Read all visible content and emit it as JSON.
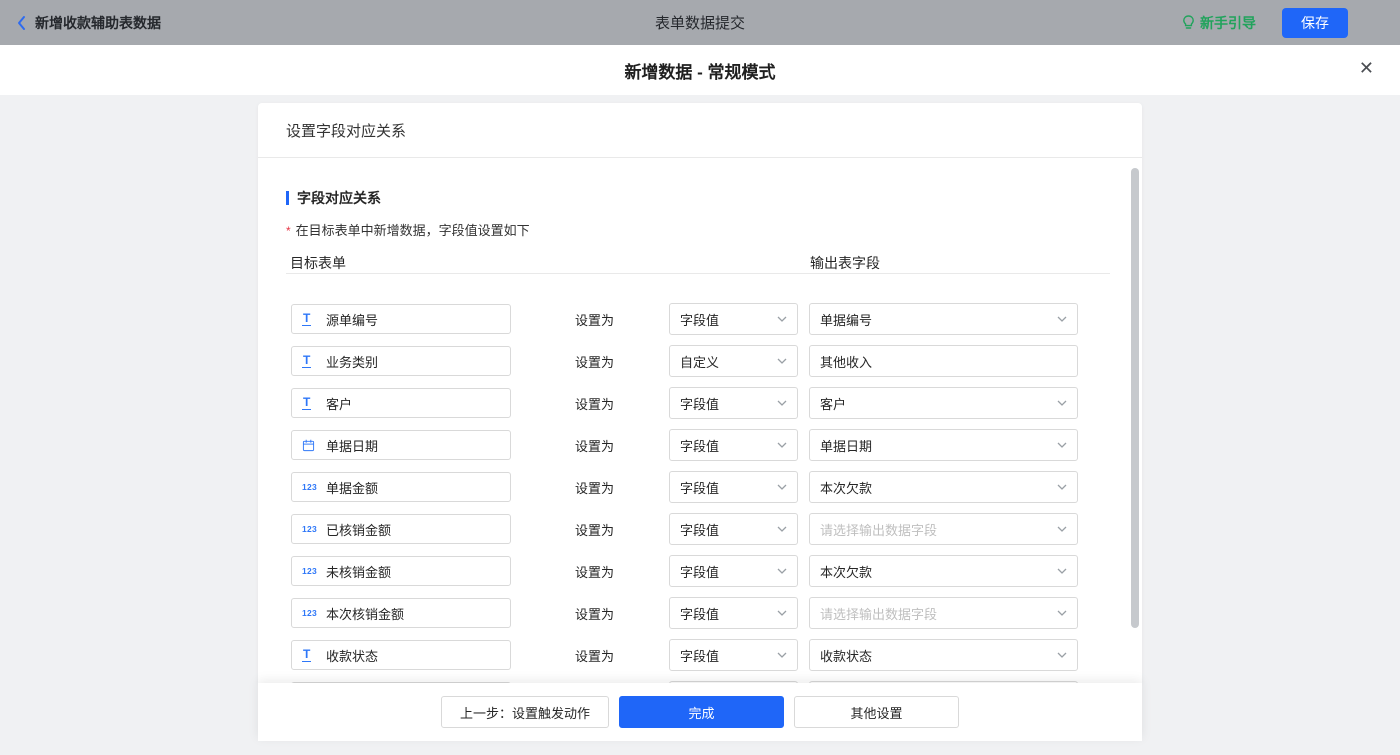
{
  "topbar": {
    "back_label": "新增收款辅助表数据",
    "center_title": "表单数据提交",
    "guide_label": "新手引导",
    "save_label": "保存"
  },
  "modal": {
    "title": "新增数据 - 常规模式",
    "close_glyph": "✕"
  },
  "panel": {
    "header": "设置字段对应关系",
    "section_title": "字段对应关系",
    "hint_mark": "*",
    "hint": "在目标表单中新增数据，字段值设置如下",
    "col_target": "目标表单",
    "col_output": "输出表字段",
    "set_as": "设置为"
  },
  "icons": {
    "text_glyph": "T",
    "number_glyph": "123"
  },
  "rows": [
    {
      "icon": "text",
      "field": "源单编号",
      "mode": "字段值",
      "output": "单据编号"
    },
    {
      "icon": "text",
      "field": "业务类别",
      "mode": "自定义",
      "output": "其他收入",
      "output_is_input": true
    },
    {
      "icon": "text",
      "field": "客户",
      "mode": "字段值",
      "output": "客户"
    },
    {
      "icon": "date",
      "field": "单据日期",
      "mode": "字段值",
      "output": "单据日期"
    },
    {
      "icon": "number",
      "field": "单据金额",
      "mode": "字段值",
      "output": "本次欠款"
    },
    {
      "icon": "number",
      "field": "已核销金额",
      "mode": "字段值",
      "output": "请选择输出数据字段",
      "output_is_placeholder": true
    },
    {
      "icon": "number",
      "field": "未核销金额",
      "mode": "字段值",
      "output": "本次欠款"
    },
    {
      "icon": "number",
      "field": "本次核销金额",
      "mode": "字段值",
      "output": "请选择输出数据字段",
      "output_is_placeholder": true
    },
    {
      "icon": "text",
      "field": "收款状态",
      "mode": "字段值",
      "output": "收款状态"
    },
    {
      "icon": "none",
      "field": "",
      "mode": "",
      "output": ""
    }
  ],
  "footer": {
    "prev_label": "上一步：设置触发动作",
    "done_label": "完成",
    "other_label": "其他设置"
  },
  "colors": {
    "primary_blue": "#1f66f8",
    "success_green": "#21a35c",
    "danger_red": "#e63746",
    "topbar_bg": "#a6a9ae",
    "field_icon_blue": "#2e77f8"
  }
}
